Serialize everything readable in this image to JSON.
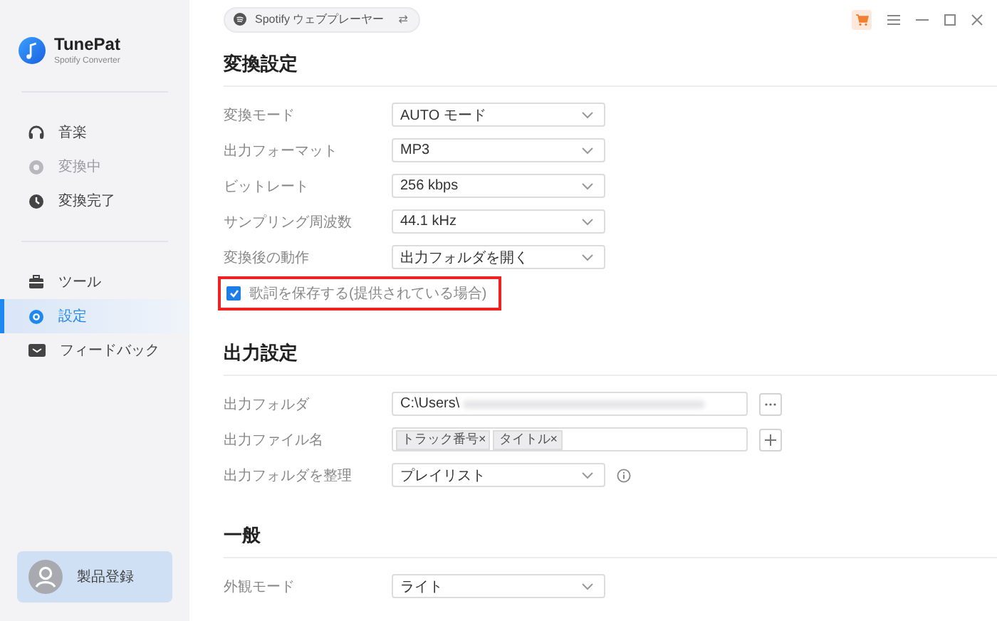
{
  "app": {
    "name": "TunePat",
    "subtitle": "Spotify Converter"
  },
  "sidebar": {
    "groups": [
      [
        {
          "kind": "music",
          "label": "音楽",
          "disabled": false,
          "selected": false
        },
        {
          "kind": "converting",
          "label": "変換中",
          "disabled": true,
          "selected": false
        },
        {
          "kind": "converted",
          "label": "変換完了",
          "disabled": false,
          "selected": false
        }
      ],
      [
        {
          "kind": "tools",
          "label": "ツール",
          "disabled": false,
          "selected": false
        },
        {
          "kind": "settings",
          "label": "設定",
          "disabled": false,
          "selected": true
        },
        {
          "kind": "feedback",
          "label": "フィードバック",
          "disabled": false,
          "selected": false
        }
      ]
    ],
    "register": {
      "label": "製品登録"
    }
  },
  "source": {
    "label": "Spotify ウェブプレーヤー",
    "switch": "⇄"
  },
  "sections": [
    {
      "title": "変換設定",
      "rows": [
        {
          "kind": "select",
          "label": "変換モード",
          "value": "AUTO モード"
        },
        {
          "kind": "select",
          "label": "出力フォーマット",
          "value": "MP3"
        },
        {
          "kind": "select",
          "label": "ビットレート",
          "value": "256 kbps"
        },
        {
          "kind": "select",
          "label": "サンプリング周波数",
          "value": "44.1 kHz"
        },
        {
          "kind": "select",
          "label": "変換後の動作",
          "value": "出力フォルダを開く"
        },
        {
          "kind": "checkbox",
          "label": "歌詞を保存する(提供されている場合)",
          "checked": true,
          "highlighted": true
        }
      ]
    },
    {
      "title": "出力設定",
      "rows": [
        {
          "kind": "path",
          "label": "出力フォルダ",
          "value": "C:\\Users\\"
        },
        {
          "kind": "tags",
          "label": "出力ファイル名",
          "tags": [
            "トラック番号",
            "タイトル"
          ],
          "remove": "×"
        },
        {
          "kind": "select_info",
          "label": "出力フォルダを整理",
          "value": "プレイリスト"
        }
      ]
    },
    {
      "title": "一般",
      "rows": [
        {
          "kind": "select",
          "label": "外観モード",
          "value": "ライト"
        }
      ]
    }
  ]
}
